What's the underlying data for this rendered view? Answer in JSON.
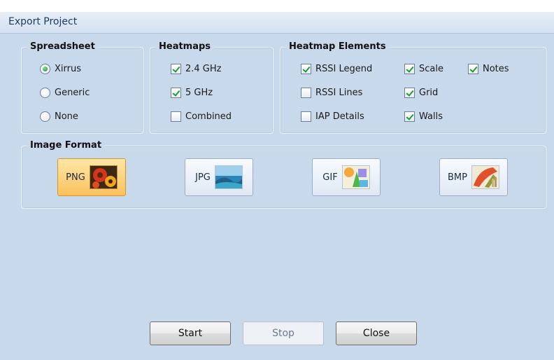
{
  "window": {
    "title": "Export Project"
  },
  "spreadsheet": {
    "legend": "Spreadsheet",
    "options": [
      {
        "label": "Xirrus",
        "checked": true
      },
      {
        "label": "Generic",
        "checked": false
      },
      {
        "label": "None",
        "checked": false
      }
    ]
  },
  "heatmaps": {
    "legend": "Heatmaps",
    "options": [
      {
        "label": "2.4 GHz",
        "checked": true
      },
      {
        "label": "5 GHz",
        "checked": true
      },
      {
        "label": "Combined",
        "checked": false
      }
    ]
  },
  "heatmap_elements": {
    "legend": "Heatmap Elements",
    "options": [
      {
        "label": "RSSI Legend",
        "checked": true
      },
      {
        "label": "Scale",
        "checked": true
      },
      {
        "label": "Notes",
        "checked": true
      },
      {
        "label": "RSSI Lines",
        "checked": false
      },
      {
        "label": "Grid",
        "checked": true
      },
      {
        "label": "IAP Details",
        "checked": false
      },
      {
        "label": "Walls",
        "checked": true
      }
    ]
  },
  "image_format": {
    "legend": "Image Format",
    "selected": "PNG",
    "formats": [
      {
        "label": "PNG",
        "icon": "flowers-image-icon"
      },
      {
        "label": "JPG",
        "icon": "landscape-image-icon"
      },
      {
        "label": "GIF",
        "icon": "shapes-image-icon"
      },
      {
        "label": "BMP",
        "icon": "paint-image-icon"
      }
    ]
  },
  "buttons": {
    "start": "Start",
    "stop": "Stop",
    "close": "Close"
  }
}
